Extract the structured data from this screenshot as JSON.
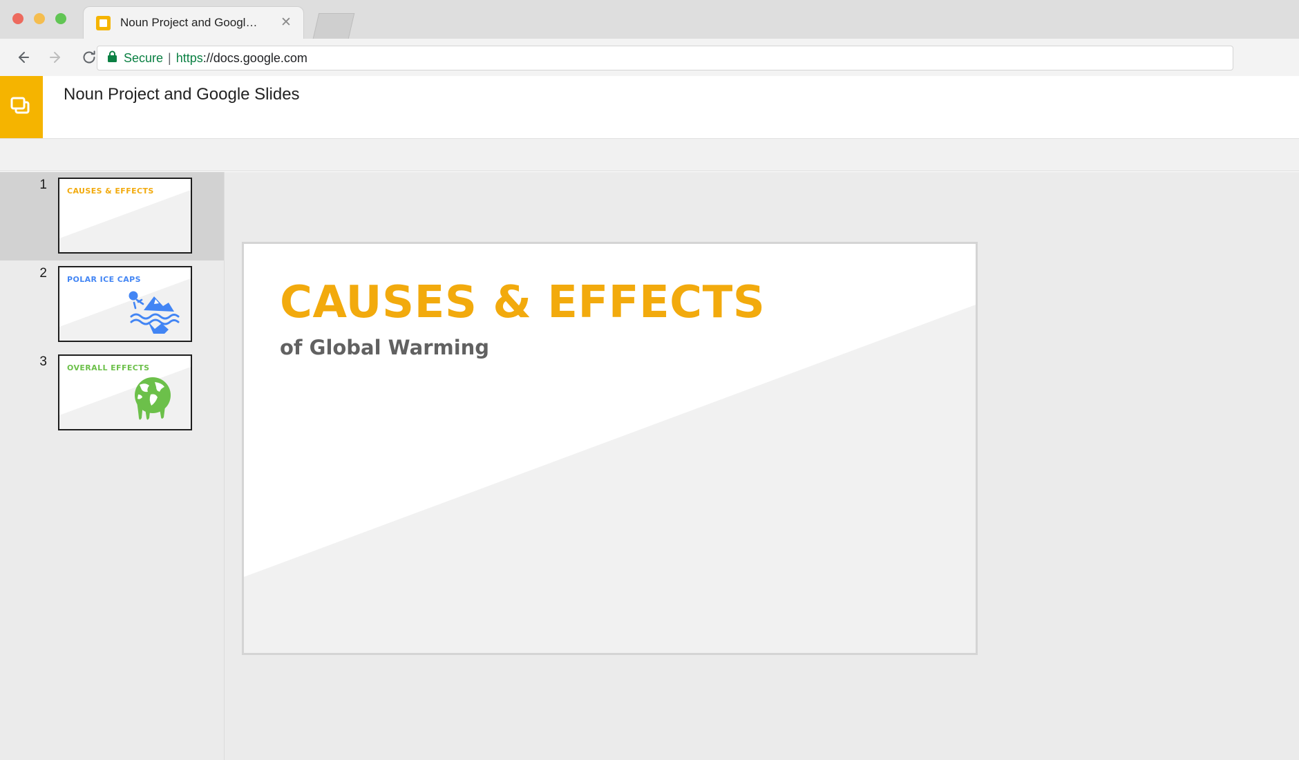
{
  "browser": {
    "tab": {
      "title": "Noun Project and Google Slides",
      "favicon_name": "slides-favicon",
      "close_label": "✕"
    },
    "address_bar": {
      "security_label": "Secure",
      "separator": "|",
      "url_scheme": "https",
      "url_rest": "://docs.google.com",
      "lock_icon": "lock-icon"
    },
    "nav": {
      "back_label": "Back",
      "forward_label": "Forward",
      "reload_label": "Reload"
    },
    "window_controls": {
      "close": "close",
      "minimize": "minimize",
      "maximize": "maximize",
      "close_color": "#ed6a5e",
      "minimize_color": "#f4bd4f",
      "maximize_color": "#61c554"
    }
  },
  "app": {
    "logo_icon": "slides-app-icon",
    "logo_color": "#f5b400",
    "doc_title": "Noun Project and Google Slides",
    "menu_placeholder_widths": [
      34,
      34,
      34,
      44,
      34,
      58,
      64,
      38,
      38,
      64,
      34,
      96,
      216
    ],
    "menu_placeholder_gap": 24,
    "actions": [
      {
        "name": "comment-button",
        "style": "split",
        "label": ""
      },
      {
        "name": "present-button",
        "style": "plain",
        "label": ""
      },
      {
        "name": "share-button",
        "style": "primary",
        "label": "",
        "color": "#4a89f3"
      }
    ]
  },
  "filmstrip": {
    "slides": [
      {
        "number": "1",
        "label": "CAUSES & EFFECTS",
        "label_color": "#f2aa0d",
        "icon": "none",
        "selected": true
      },
      {
        "number": "2",
        "label": "POLAR ICE CAPS",
        "label_color": "#4285f4",
        "icon": "iceberg-icon",
        "selected": false
      },
      {
        "number": "3",
        "label": "OVERALL EFFECTS",
        "label_color": "#6cc04a",
        "icon": "melting-globe-icon",
        "selected": false
      }
    ]
  },
  "slide_canvas": {
    "title": "CAUSES & EFFECTS",
    "title_color": "#f2aa0d",
    "subtitle": "of Global Warming",
    "subtitle_color": "#616161",
    "background_top_color": "#ffffff",
    "background_bottom_color": "#f1f1f1"
  }
}
